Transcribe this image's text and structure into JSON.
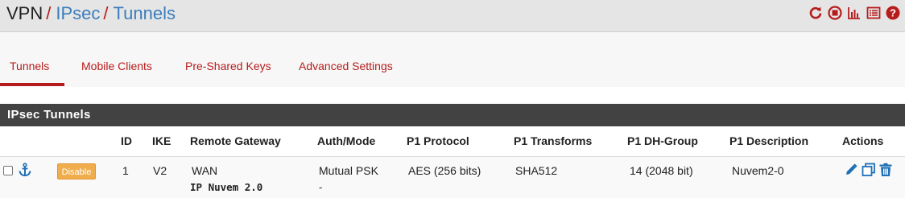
{
  "breadcrumb": {
    "vpn": "VPN",
    "separator": "/",
    "ipsec": "IPsec",
    "tunnels": "Tunnels"
  },
  "header_icons": [
    "reload-icon",
    "stop-circle-icon",
    "bar-chart-icon",
    "list-alt-icon",
    "help-circle-icon"
  ],
  "tabs": [
    {
      "label": "Tunnels",
      "active": true
    },
    {
      "label": "Mobile Clients",
      "active": false
    },
    {
      "label": "Pre-Shared Keys",
      "active": false
    },
    {
      "label": "Advanced Settings",
      "active": false
    }
  ],
  "panel": {
    "title": "IPsec Tunnels"
  },
  "table": {
    "headers": [
      "ID",
      "IKE",
      "Remote Gateway",
      "Auth/Mode",
      "P1 Protocol",
      "P1 Transforms",
      "P1 DH-Group",
      "P1 Description",
      "Actions"
    ],
    "rows": [
      {
        "disable_label": "Disable",
        "id": "1",
        "ike": "V2",
        "remote_gateway": "WAN",
        "remote_gateway_sub": "IP Nuvem 2.0",
        "auth_mode": "Mutual PSK",
        "auth_mode_sub": "-",
        "p1_protocol": "AES (256 bits)",
        "p1_transforms": "SHA512",
        "p1_dh_group": "14 (2048 bit)",
        "p1_description": "Nuvem2-0"
      }
    ]
  },
  "colors": {
    "accent_red": "#b71c1c",
    "link_blue": "#3b7dbd",
    "panel_dark": "#424242",
    "warning_orange": "#f0ad4e",
    "action_blue": "#1e6fb5"
  }
}
